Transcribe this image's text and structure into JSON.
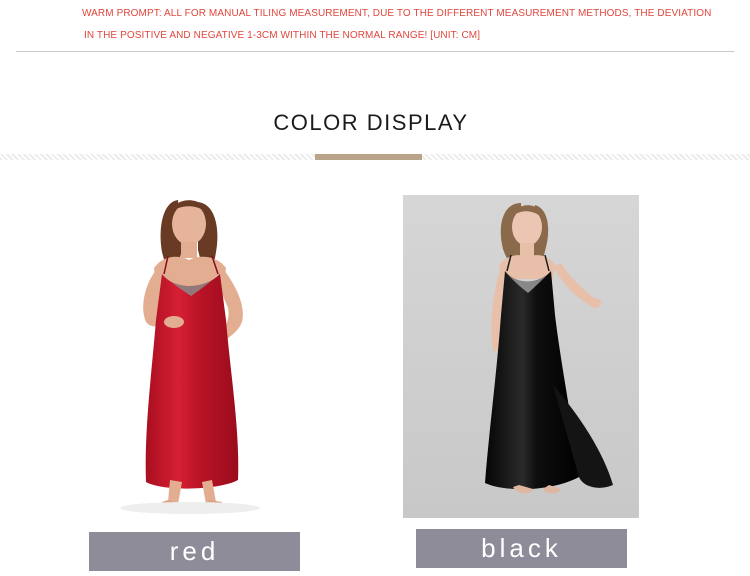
{
  "prompt": {
    "line1": "WARM PROMPT: ALL FOR MANUAL TILING MEASUREMENT, DUE TO THE DIFFERENT MEASUREMENT METHODS, THE DEVIATION",
    "line2": "IN THE POSITIVE AND NEGATIVE 1-3CM WITHIN THE NORMAL RANGE! [UNIT: CM]"
  },
  "section": {
    "title": "COLOR DISPLAY"
  },
  "colors": {
    "accent": "#b9a48b",
    "prompt_text": "#e0463c",
    "label_bg": "#8d8c98",
    "dress_red": "#c8162a",
    "dress_black": "#111111"
  },
  "products": [
    {
      "label": "red",
      "image": "woman-red-satin-nightgown-photo"
    },
    {
      "label": "black",
      "image": "woman-black-satin-nightgown-photo"
    }
  ]
}
